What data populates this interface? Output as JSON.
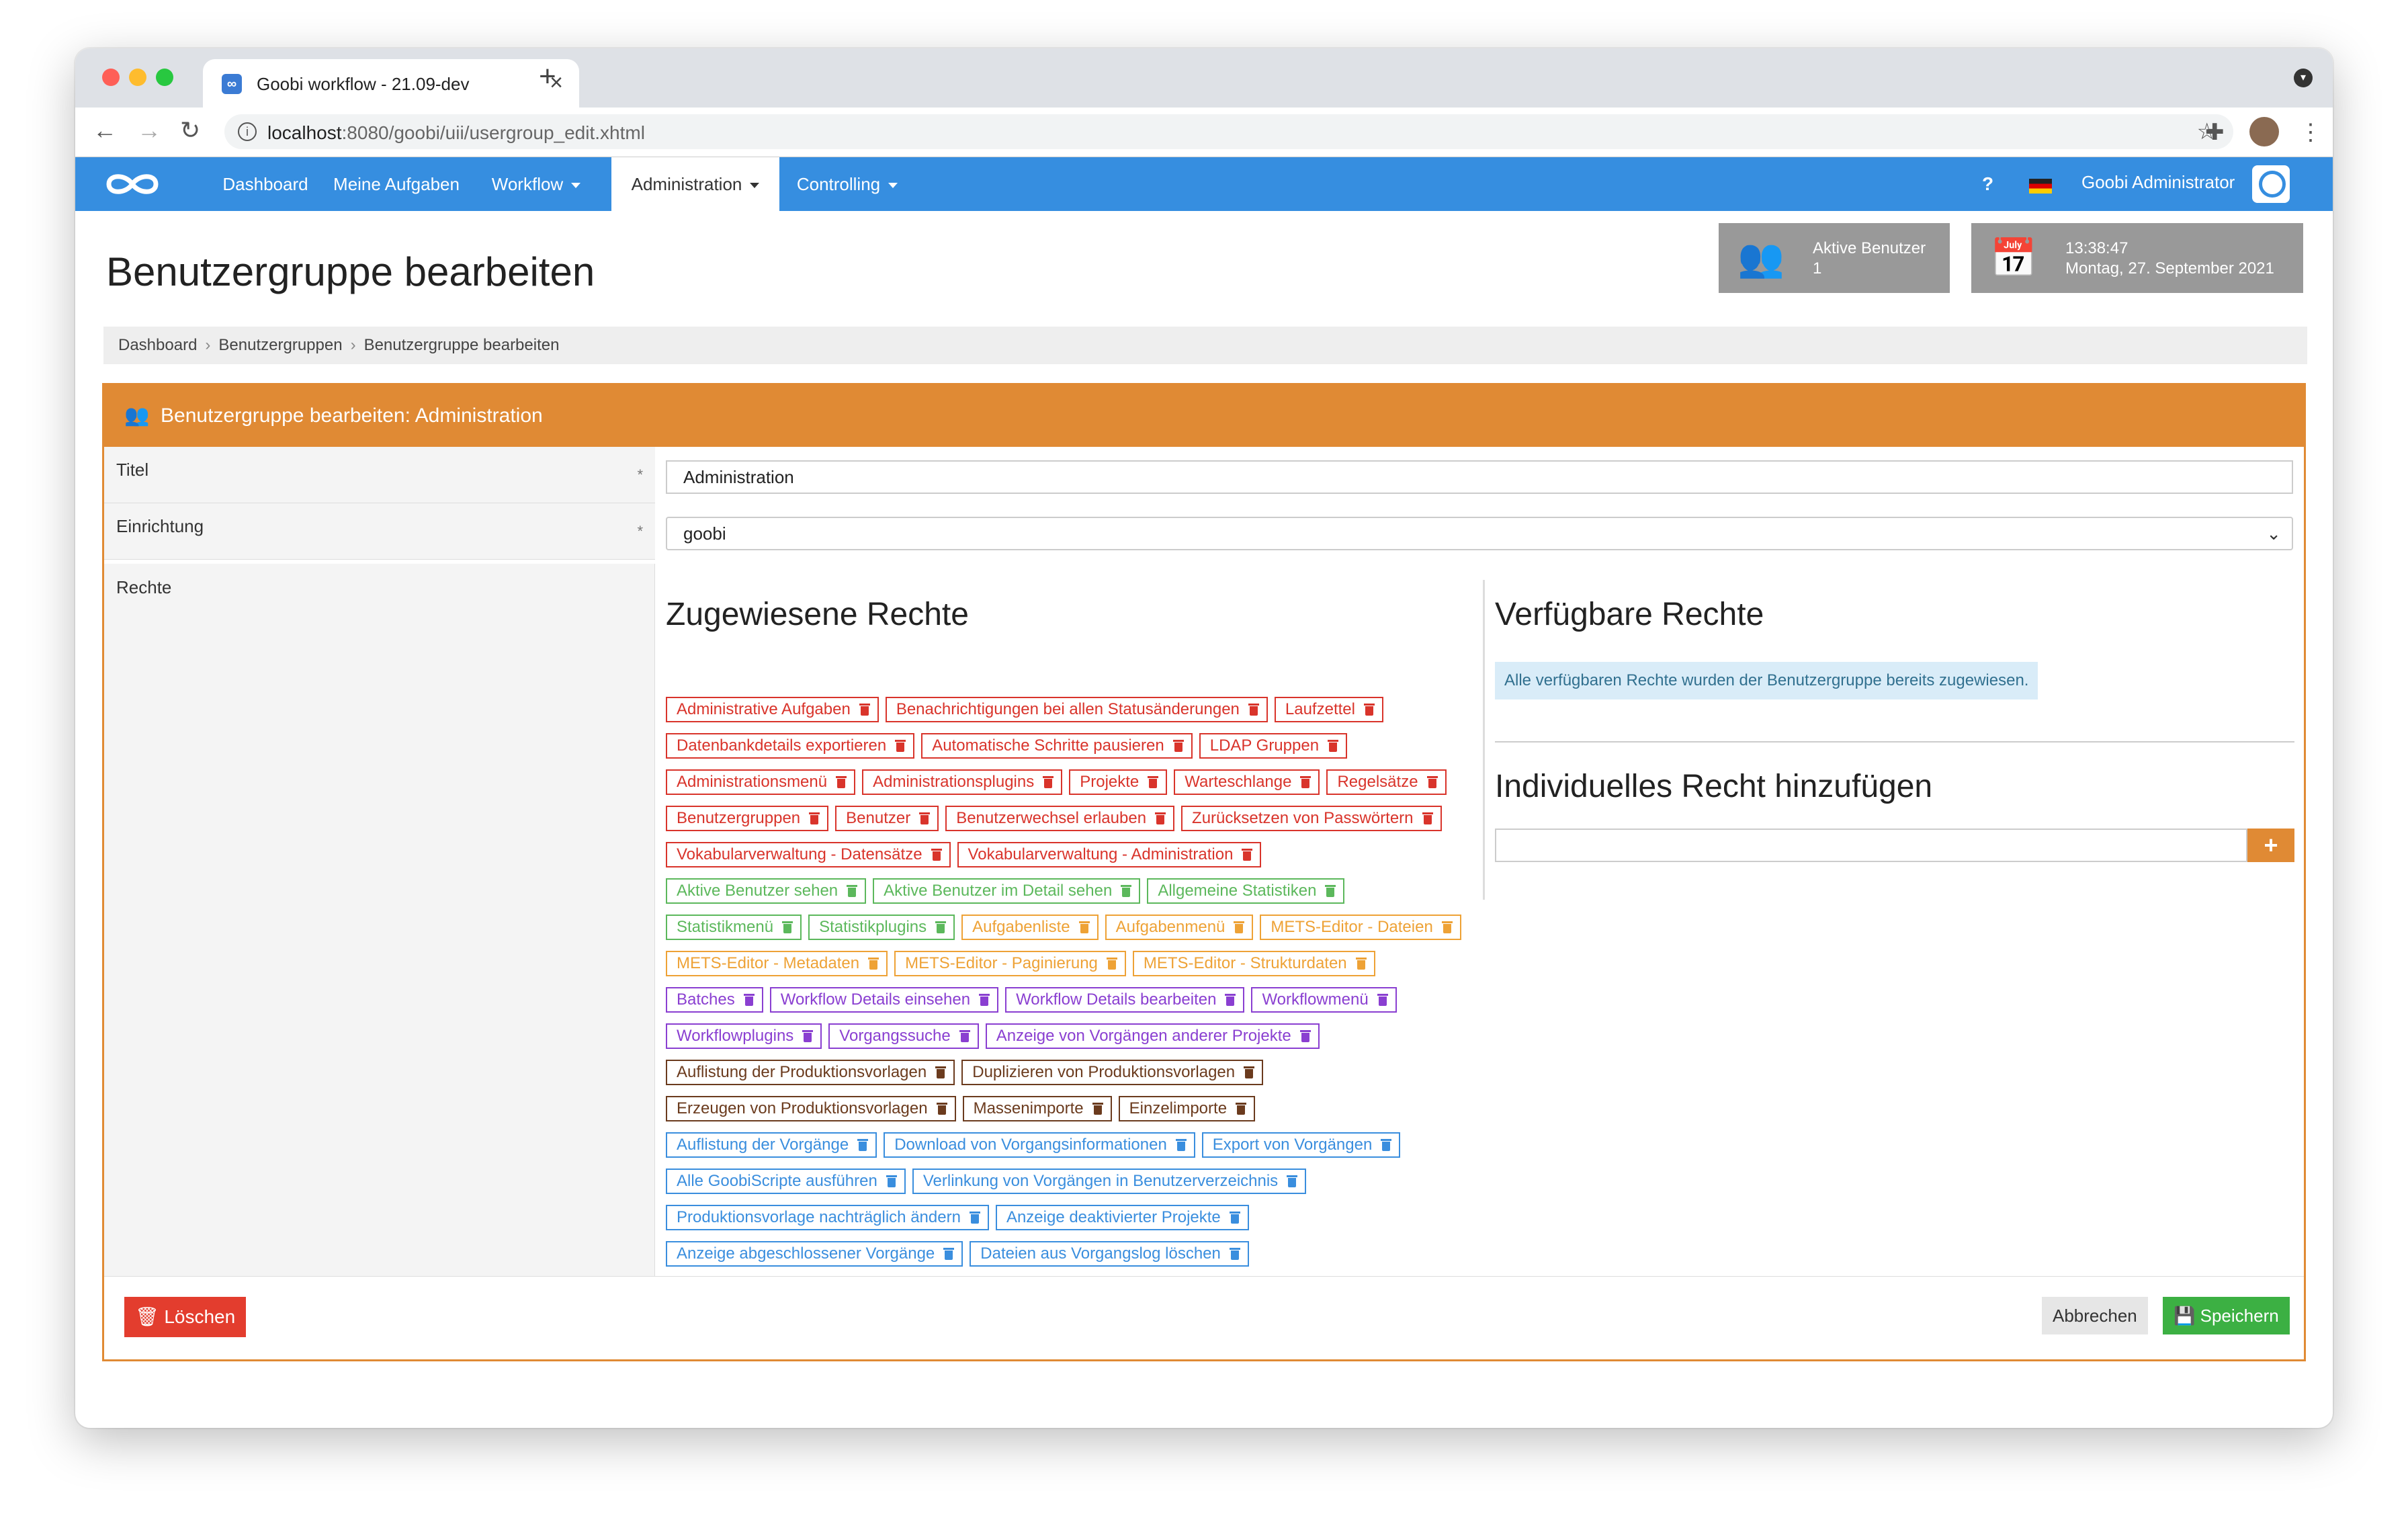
{
  "browser": {
    "tab_title": "Goobi workflow - 21.09-dev",
    "url_host": "localhost",
    "url_rest": ":8080/goobi/uii/usergroup_edit.xhtml"
  },
  "nav": {
    "items": [
      {
        "label": "Dashboard",
        "dropdown": false,
        "active": false
      },
      {
        "label": "Meine Aufgaben",
        "dropdown": false,
        "active": false
      },
      {
        "label": "Workflow",
        "dropdown": true,
        "active": false
      },
      {
        "label": "Administration",
        "dropdown": true,
        "active": true
      },
      {
        "label": "Controlling",
        "dropdown": true,
        "active": false
      }
    ],
    "help": "?",
    "user": "Goobi Administrator"
  },
  "page": {
    "title": "Benutzergruppe bearbeiten",
    "active_users_label": "Aktive Benutzer",
    "active_users_count": "1",
    "time": "13:38:47",
    "date": "Montag, 27. September 2021"
  },
  "breadcrumb": [
    "Dashboard",
    "Benutzergruppen",
    "Benutzergruppe bearbeiten"
  ],
  "form": {
    "header": "Benutzergruppe bearbeiten: Administration",
    "title_label": "Titel",
    "title_value": "Administration",
    "institution_label": "Einrichtung",
    "institution_value": "goobi",
    "required_mark": "*",
    "rights_label": "Rechte",
    "assigned_heading": "Zugewiesene Rechte",
    "available_heading": "Verfügbare Rechte",
    "available_info": "Alle verfügbaren Rechte wurden der Benutzergruppe bereits zugewiesen.",
    "individual_heading": "Individuelles Recht hinzufügen",
    "individual_value": "",
    "add_button": "+",
    "delete_button": "Löschen",
    "cancel_button": "Abbrechen",
    "save_button": "Speichern"
  },
  "colors": {
    "red": "#d9342b",
    "green": "#5cb85c",
    "orange": "#eea236",
    "purple": "#8a3fd1",
    "brown": "#6b3b1e",
    "blue": "#3a8ede",
    "nav": "#368ee0",
    "panel": "#e08a34"
  },
  "rights": [
    {
      "label": "Administrative Aufgaben",
      "color": "red"
    },
    {
      "label": "Benachrichtigungen bei allen Statusänderungen",
      "color": "red"
    },
    {
      "label": "Laufzettel",
      "color": "red"
    },
    {
      "label": "Datenbankdetails exportieren",
      "color": "red"
    },
    {
      "label": "Automatische Schritte pausieren",
      "color": "red"
    },
    {
      "label": "LDAP Gruppen",
      "color": "red"
    },
    {
      "label": "Administrationsmenü",
      "color": "red"
    },
    {
      "label": "Administrationsplugins",
      "color": "red"
    },
    {
      "label": "Projekte",
      "color": "red"
    },
    {
      "label": "Warteschlange",
      "color": "red"
    },
    {
      "label": "Regelsätze",
      "color": "red"
    },
    {
      "label": "Benutzergruppen",
      "color": "red"
    },
    {
      "label": "Benutzer",
      "color": "red"
    },
    {
      "label": "Benutzerwechsel erlauben",
      "color": "red"
    },
    {
      "label": "Zurücksetzen von Passwörtern",
      "color": "red"
    },
    {
      "label": "Vokabularverwaltung - Datensätze",
      "color": "red"
    },
    {
      "label": "Vokabularverwaltung - Administration",
      "color": "red"
    },
    {
      "label": "Aktive Benutzer sehen",
      "color": "green"
    },
    {
      "label": "Aktive Benutzer im Detail sehen",
      "color": "green"
    },
    {
      "label": "Allgemeine Statistiken",
      "color": "green"
    },
    {
      "label": "Statistikmenü",
      "color": "green"
    },
    {
      "label": "Statistikplugins",
      "color": "green"
    },
    {
      "label": "Aufgabenliste",
      "color": "orange"
    },
    {
      "label": "Aufgabenmenü",
      "color": "orange"
    },
    {
      "label": "METS-Editor - Dateien",
      "color": "orange"
    },
    {
      "label": "METS-Editor - Metadaten",
      "color": "orange"
    },
    {
      "label": "METS-Editor - Paginierung",
      "color": "orange"
    },
    {
      "label": "METS-Editor - Strukturdaten",
      "color": "orange"
    },
    {
      "label": "Batches",
      "color": "purple"
    },
    {
      "label": "Workflow Details einsehen",
      "color": "purple"
    },
    {
      "label": "Workflow Details bearbeiten",
      "color": "purple"
    },
    {
      "label": "Workflowmenü",
      "color": "purple"
    },
    {
      "label": "Workflowplugins",
      "color": "purple"
    },
    {
      "label": "Vorgangssuche",
      "color": "purple"
    },
    {
      "label": "Anzeige von Vorgängen anderer Projekte",
      "color": "purple"
    },
    {
      "label": "Auflistung der Produktionsvorlagen",
      "color": "brown"
    },
    {
      "label": "Duplizieren von Produktionsvorlagen",
      "color": "brown"
    },
    {
      "label": "Erzeugen von Produktionsvorlagen",
      "color": "brown"
    },
    {
      "label": "Massenimporte",
      "color": "brown"
    },
    {
      "label": "Einzelimporte",
      "color": "brown"
    },
    {
      "label": "Auflistung der Vorgänge",
      "color": "blue"
    },
    {
      "label": "Download von Vorgangsinformationen",
      "color": "blue"
    },
    {
      "label": "Export von Vorgängen",
      "color": "blue"
    },
    {
      "label": "Alle GoobiScripte ausführen",
      "color": "blue"
    },
    {
      "label": "Verlinkung von Vorgängen in Benutzerverzeichnis",
      "color": "blue"
    },
    {
      "label": "Produktionsvorlage nachträglich ändern",
      "color": "blue"
    },
    {
      "label": "Anzeige deaktivierter Projekte",
      "color": "blue"
    },
    {
      "label": "Anzeige abgeschlossener Vorgänge",
      "color": "blue"
    },
    {
      "label": "Dateien aus Vorgangslog löschen",
      "color": "blue"
    }
  ]
}
